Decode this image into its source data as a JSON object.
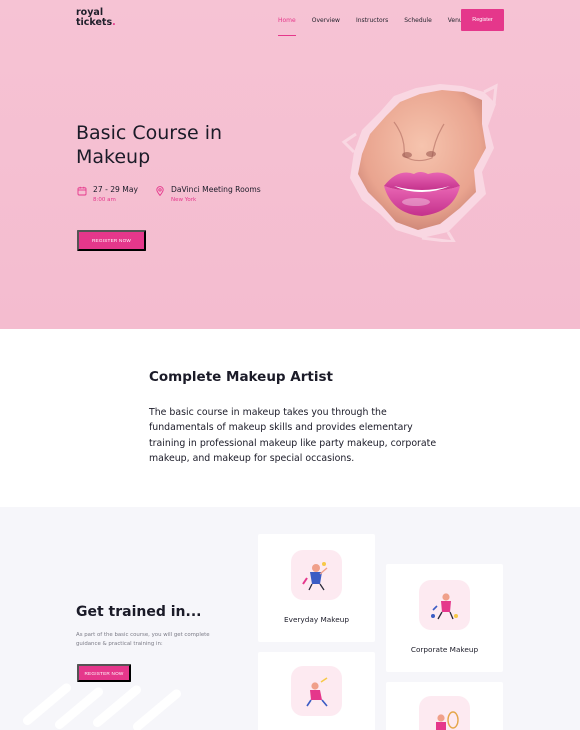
{
  "brand": {
    "line1": "royal",
    "line2": "tickets",
    "dot": "."
  },
  "nav": {
    "items": [
      {
        "label": "Home",
        "active": true
      },
      {
        "label": "Overview"
      },
      {
        "label": "Instructors"
      },
      {
        "label": "Schedule"
      },
      {
        "label": "Venue"
      }
    ],
    "register_label": "Register"
  },
  "hero": {
    "title": "Basic Course in Makeup",
    "date": {
      "main": "27 - 29 May",
      "sub": "8:00 am"
    },
    "venue": {
      "main": "DaVinci Meeting Rooms",
      "sub": "New York"
    },
    "cta_label": "REGISTER NOW"
  },
  "about": {
    "title": "Complete Makeup Artist",
    "text": "The basic course in makeup takes you through the fundamentals of makeup skills and provides elementary training in professional makeup like party makeup, corporate makeup, and makeup for special occasions."
  },
  "training": {
    "title": "Get trained in...",
    "text": "As part of the basic course, you will get complete guidance & practical training in:",
    "cta_label": "REGISTER NOW",
    "cards": [
      {
        "label": "Everyday Makeup"
      },
      {
        "label": "Corporate Makeup"
      },
      {
        "label": ""
      },
      {
        "label": ""
      }
    ]
  },
  "colors": {
    "accent": "#e5378b",
    "hero_bg": "#f5c0d2",
    "section_bg": "#f6f6fa"
  }
}
